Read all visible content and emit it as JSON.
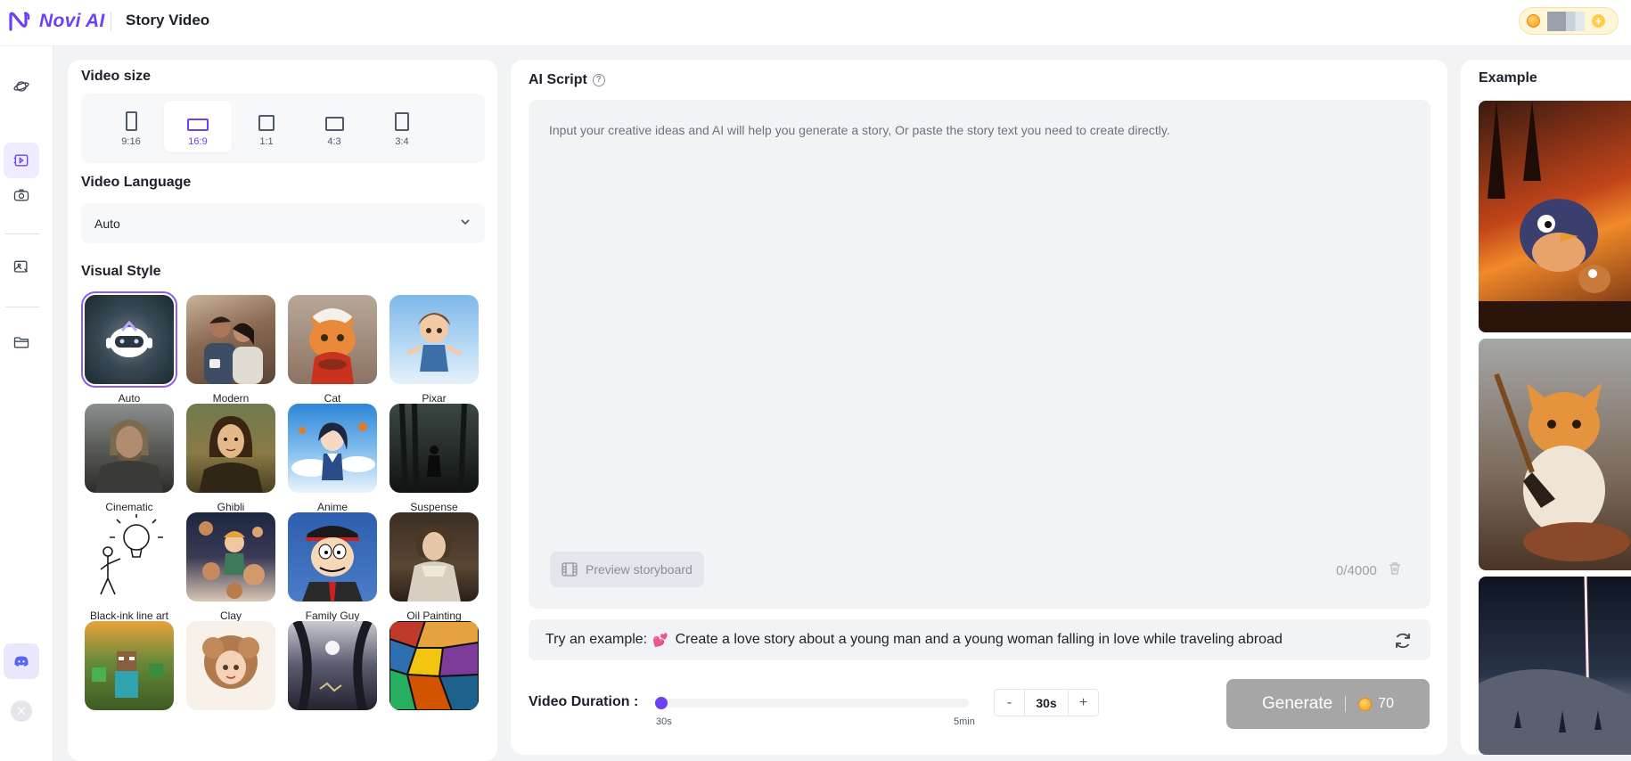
{
  "app": {
    "brand": "Novi AI",
    "page_title": "Story Video"
  },
  "rail": {
    "items": [
      "planet-icon",
      "story-video-icon",
      "camera-icon",
      "image-edit-icon",
      "folder-icon"
    ],
    "social": [
      "discord-icon",
      "x-icon"
    ]
  },
  "left": {
    "video_size_title": "Video size",
    "sizes": [
      {
        "label": "9:16"
      },
      {
        "label": "16:9",
        "selected": true
      },
      {
        "label": "1:1"
      },
      {
        "label": "4:3"
      },
      {
        "label": "3:4"
      }
    ],
    "language_title": "Video Language",
    "language_value": "Auto",
    "visual_style_title": "Visual Style",
    "styles": [
      "Auto",
      "Modern",
      "Cat",
      "Pixar",
      "Cinematic",
      "Ghibli",
      "Anime",
      "Suspense",
      "Black-ink line art",
      "Clay",
      "Family Guy",
      "Oil Painting"
    ],
    "selected_style": "Auto"
  },
  "main": {
    "script_title": "AI Script",
    "placeholder": "Input your creative ideas and AI will help you generate a story, Or paste the story text you need to create directly.",
    "preview_label": "Preview storyboard",
    "counter": "0/4000",
    "example_prefix": "Try an example:",
    "example_text": "Create a love story about a young man and a young woman falling in love while traveling abroad",
    "duration_label": "Video Duration :",
    "duration_min": "30s",
    "duration_max": "5min",
    "duration_value": "30s",
    "duration_progress": 0,
    "minus": "-",
    "plus": "+",
    "generate_label": "Generate",
    "generate_cost": "70"
  },
  "right": {
    "example_title": "Example"
  },
  "colors": {
    "accent": "#6c40f5",
    "generate_bg": "#a6a6a6",
    "coin": "#f39a12"
  }
}
